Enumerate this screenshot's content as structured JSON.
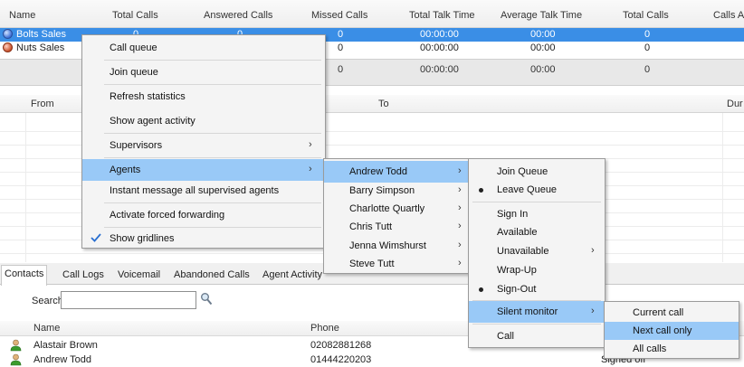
{
  "queue_table": {
    "headers": [
      "Name",
      "Total Calls",
      "Answered Calls",
      "Missed Calls",
      "Total Talk Time",
      "Average Talk Time",
      "Total Calls",
      "Calls A"
    ],
    "rows": [
      {
        "name": "Bolts Sales",
        "total": "0",
        "answered": "0",
        "missed": "0",
        "talk": "00:00:00",
        "avg": "00:00",
        "total2": "0"
      },
      {
        "name": "Nuts Sales",
        "total": "",
        "answered": "",
        "missed": "0",
        "talk": "00:00:00",
        "avg": "00:00",
        "total2": "0"
      }
    ],
    "summary": {
      "missed": "0",
      "talk": "00:00:00",
      "avg": "00:00",
      "total2": "0"
    }
  },
  "call_log": {
    "headers": {
      "from": "From",
      "to": "To",
      "duration": "Dur"
    }
  },
  "context_menu": {
    "items": [
      {
        "label": "Call queue"
      },
      {
        "label": "Join queue"
      },
      {
        "label": "Refresh statistics"
      },
      {
        "label": "Show agent activity"
      },
      {
        "label": "Supervisors",
        "arrow": "›"
      },
      {
        "label": "Agents",
        "arrow": "›"
      },
      {
        "label": "Instant message all supervised agents"
      },
      {
        "label": "Activate forced forwarding"
      },
      {
        "label": "Show gridlines"
      }
    ]
  },
  "agents_menu": {
    "items": [
      {
        "label": "Andrew Todd",
        "arrow": "›"
      },
      {
        "label": "Barry Simpson",
        "arrow": "›"
      },
      {
        "label": "Charlotte Quartly",
        "arrow": "›"
      },
      {
        "label": "Chris Tutt",
        "arrow": "›"
      },
      {
        "label": "Jenna Wimshurst",
        "arrow": "›"
      },
      {
        "label": "Steve Tutt",
        "arrow": "›"
      }
    ]
  },
  "agent_actions_menu": {
    "items": [
      {
        "label": "Join Queue"
      },
      {
        "label": "Leave Queue"
      },
      {
        "label": "Sign In"
      },
      {
        "label": "Available"
      },
      {
        "label": "Unavailable",
        "arrow": "›"
      },
      {
        "label": "Wrap-Up"
      },
      {
        "label": "Sign-Out"
      },
      {
        "label": "Silent monitor",
        "arrow": "›"
      },
      {
        "label": "Call"
      }
    ]
  },
  "silent_monitor_menu": {
    "items": [
      {
        "label": "Current call"
      },
      {
        "label": "Next call only"
      },
      {
        "label": "All calls"
      }
    ]
  },
  "tabs": [
    "Contacts",
    "Call Logs",
    "Voicemail",
    "Abandoned Calls",
    "Agent Activity"
  ],
  "contacts": {
    "search_label": "Search",
    "search_value": "",
    "headers": {
      "name": "Name",
      "phone": "Phone"
    },
    "rows": [
      {
        "name": "Alastair Brown",
        "phone": "02082881268"
      },
      {
        "name": "Andrew Todd",
        "phone": "01444220203",
        "status": "Signed off"
      }
    ]
  },
  "colors": {
    "selection": "#3a8ee6",
    "menu_highlight": "#99c9f7"
  },
  "icons": {
    "queue_bolts": "status-blue-icon",
    "queue_nuts": "status-red-icon",
    "search": "magnifier-icon",
    "contact": "person-icon",
    "check": "check-icon"
  }
}
